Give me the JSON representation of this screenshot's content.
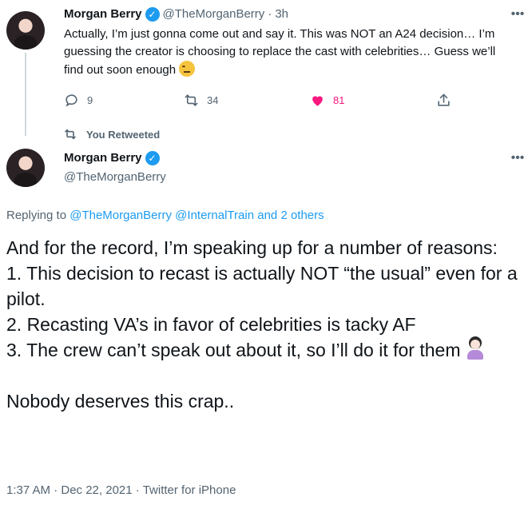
{
  "tweet1": {
    "author_name": "Morgan Berry",
    "handle": "@TheMorganBerry",
    "separator": "·",
    "time": "3h",
    "text": "Actually, I’m just gonna come out and say it. This was NOT an A24 decision… I’m guessing the creator is choosing to replace the cast with celebrities… Guess we’ll find out soon enough ",
    "emoji": "face-with-rolling-eyes",
    "actions": {
      "replies": "9",
      "retweets": "34",
      "likes": "81"
    },
    "more_icon": "more-icon"
  },
  "retweet_label": "You Retweeted",
  "tweet2": {
    "author_name": "Morgan Berry",
    "handle": "@TheMorganBerry",
    "replying_prefix": "Replying to",
    "replying_to": [
      "@TheMorganBerry",
      "@InternalTrain"
    ],
    "replying_and": "and",
    "replying_others": "2 others",
    "text_lines": [
      "And for the record, I’m speaking up for a number of reasons:",
      "1. This decision to recast is actually NOT “the usual” even for a pilot.",
      "2. Recasting VA’s in favor of celebrities is tacky AF",
      "3. The crew can’t speak out about it, so I’ll do it for them"
    ],
    "emoji": "person-shrugging",
    "closing": "Nobody deserves this crap..",
    "timestamp": "1:37 AM · Dec 22, 2021",
    "separator": "·",
    "source": "Twitter for iPhone",
    "more_icon": "more-icon"
  },
  "colors": {
    "text": "#0f1419",
    "secondary": "#536471",
    "link": "#1d9bf0",
    "like": "#f91880",
    "verified": "#1d9bf0"
  }
}
